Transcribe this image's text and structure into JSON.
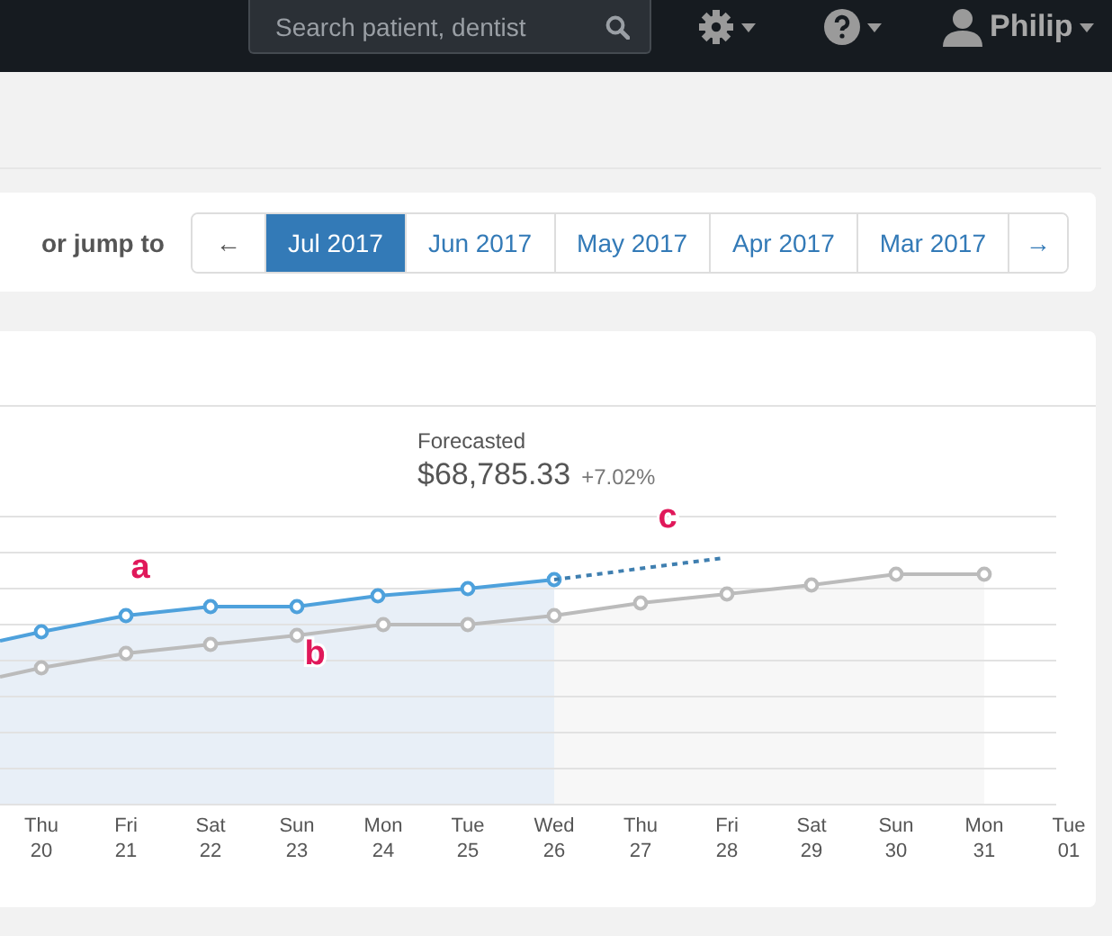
{
  "navbar": {
    "search": {
      "placeholder": "Search patient, dentist"
    },
    "user": {
      "name": "Philip"
    }
  },
  "jump": {
    "label": "or jump to",
    "prev": "←",
    "next": "→",
    "months": [
      {
        "label": "Jul 2017",
        "selected": true
      },
      {
        "label": "Jun 2017",
        "selected": false
      },
      {
        "label": "May 2017",
        "selected": false
      },
      {
        "label": "Apr 2017",
        "selected": false
      },
      {
        "label": "Mar 2017",
        "selected": false
      }
    ]
  },
  "forecast": {
    "title": "Forecasted",
    "amount": "$68,785.33",
    "change": "+7.02%"
  },
  "chart": {
    "series_labels": [
      "a",
      "b",
      "c"
    ],
    "x_labels": [
      {
        "day": "Thu",
        "date": "20"
      },
      {
        "day": "Fri",
        "date": "21"
      },
      {
        "day": "Sat",
        "date": "22"
      },
      {
        "day": "Sun",
        "date": "23"
      },
      {
        "day": "Mon",
        "date": "24"
      },
      {
        "day": "Tue",
        "date": "25"
      },
      {
        "day": "Wed",
        "date": "26"
      },
      {
        "day": "Thu",
        "date": "27"
      },
      {
        "day": "Fri",
        "date": "28"
      },
      {
        "day": "Sat",
        "date": "29"
      },
      {
        "day": "Sun",
        "date": "30"
      },
      {
        "day": "Mon",
        "date": "31"
      },
      {
        "day": "Tue",
        "date": "01"
      }
    ]
  }
}
